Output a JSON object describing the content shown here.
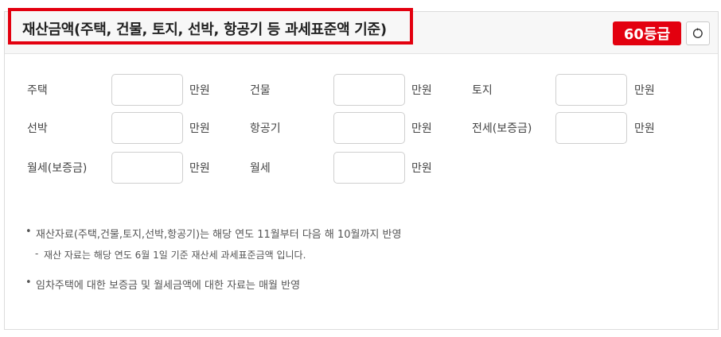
{
  "header": {
    "title": "재산금액(주택, 건물, 토지, 선박, 항공기 등 과세표준액 기준)",
    "grade_badge": "60등급",
    "refresh_icon": "refresh-icon"
  },
  "colors": {
    "accent": "#e3000f"
  },
  "fields": [
    {
      "label": "주택",
      "value": "",
      "unit": "만원"
    },
    {
      "label": "건물",
      "value": "",
      "unit": "만원"
    },
    {
      "label": "토지",
      "value": "",
      "unit": "만원"
    },
    {
      "label": "선박",
      "value": "",
      "unit": "만원"
    },
    {
      "label": "항공기",
      "value": "",
      "unit": "만원"
    },
    {
      "label": "전세(보증금)",
      "value": "",
      "unit": "만원"
    },
    {
      "label": "월세(보증금)",
      "value": "",
      "unit": "만원"
    },
    {
      "label": "월세",
      "value": "",
      "unit": "만원"
    }
  ],
  "notes": {
    "note1": "재산자료(주택,건물,토지,선박,항공기)는 해당 연도 11월부터 다음 해 10월까지 반영",
    "note1_sub": "재산 자료는 해당 연도 6월 1일 기준 재산세 과세표준금액 입니다.",
    "note2": "임차주택에 대한 보증금 및 월세금액에 대한 자료는 매월 반영"
  }
}
